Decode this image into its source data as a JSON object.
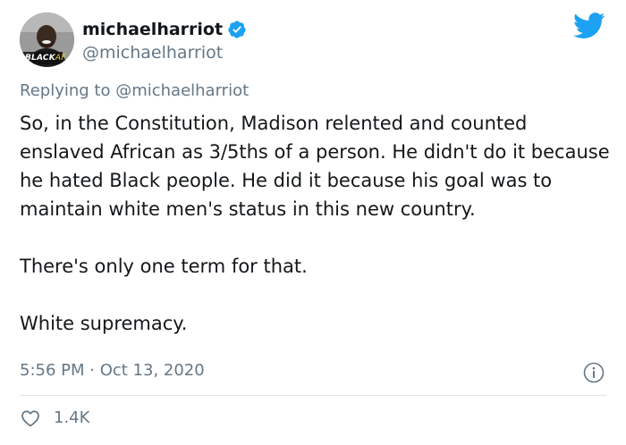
{
  "author": {
    "display_name": "michaelharriot",
    "handle": "@michaelharriot",
    "verified": true,
    "avatar_badge_main": "BLACK",
    "avatar_badge_suffix": "AF"
  },
  "reply": {
    "prefix": "Replying to ",
    "mention": "@michaelharriot"
  },
  "tweet": {
    "paragraphs": [
      "So, in the Constitution, Madison relented and counted enslaved African as 3/5ths of a person. He didn't do it because he hated Black people. He did it because his goal was to maintain white men's status in this new country.",
      "There's only one term for that.",
      "White supremacy."
    ]
  },
  "meta": {
    "timestamp": "5:56 PM · Oct 13, 2020"
  },
  "engagement": {
    "like_count": "1.4K"
  },
  "icons": {
    "logo": "twitter-bird-icon",
    "verified": "verified-badge-icon",
    "info": "info-icon",
    "like": "heart-icon"
  },
  "colors": {
    "twitter_blue": "#1da1f2",
    "text_primary": "#14171a",
    "text_secondary": "#657786",
    "divider": "#dfe5ea"
  }
}
